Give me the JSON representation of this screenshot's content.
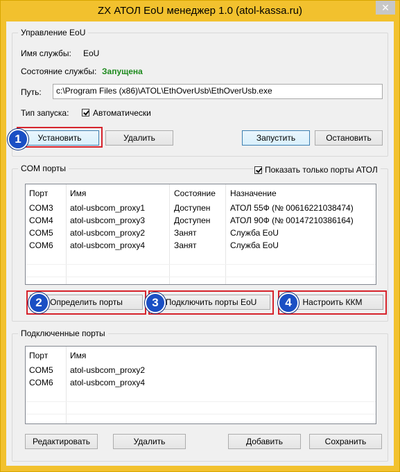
{
  "window": {
    "title": "ZX АТОЛ EoU менеджер 1.0 (atol-kassa.ru)",
    "close_glyph": "✕"
  },
  "eou": {
    "group_title": "Управление EoU",
    "service_name_label": "Имя службы:",
    "service_name_value": "EoU",
    "state_label": "Состояние службы:",
    "state_value": "Запущена",
    "path_label": "Путь:",
    "path_value": "c:\\Program Files (x86)\\ATOL\\EthOverUsb\\EthOverUsb.exe",
    "startup_label": "Тип запуска:",
    "startup_checkbox_label": "Автоматически",
    "install_button": "Установить",
    "remove_button": "Удалить",
    "start_button": "Запустить",
    "stop_button": "Остановить"
  },
  "com": {
    "group_title": "COM порты",
    "filter_label": "Показать только порты АТОЛ",
    "columns": [
      "Порт",
      "Имя",
      "Состояние",
      "Назначение"
    ],
    "rows": [
      [
        "COM3",
        "atol-usbcom_proxy1",
        "Доступен",
        "АТОЛ 55Ф (№ 00616221038474)"
      ],
      [
        "COM4",
        "atol-usbcom_proxy3",
        "Доступен",
        "АТОЛ 90Ф (№ 00147210386164)"
      ],
      [
        "COM5",
        "atol-usbcom_proxy2",
        "Занят",
        "Служба EoU"
      ],
      [
        "COM6",
        "atol-usbcom_proxy4",
        "Занят",
        "Служба EoU"
      ]
    ],
    "detect_button": "Определить порты",
    "connect_button": "Подключить порты EoU",
    "configure_button": "Настроить ККМ"
  },
  "connected": {
    "group_title": "Подключенные порты",
    "columns": [
      "Порт",
      "Имя"
    ],
    "rows": [
      [
        "COM5",
        "atol-usbcom_proxy2"
      ],
      [
        "COM6",
        "atol-usbcom_proxy4"
      ]
    ],
    "edit_button": "Редактировать",
    "delete_button": "Удалить",
    "add_button": "Добавить",
    "save_button": "Сохранить"
  },
  "badges": [
    "1",
    "2",
    "3",
    "4"
  ],
  "colors": {
    "titlebar": "#f2c12e",
    "running": "#1e8a1e",
    "highlight": "#d6232b",
    "badge": "#1a4fc4"
  }
}
